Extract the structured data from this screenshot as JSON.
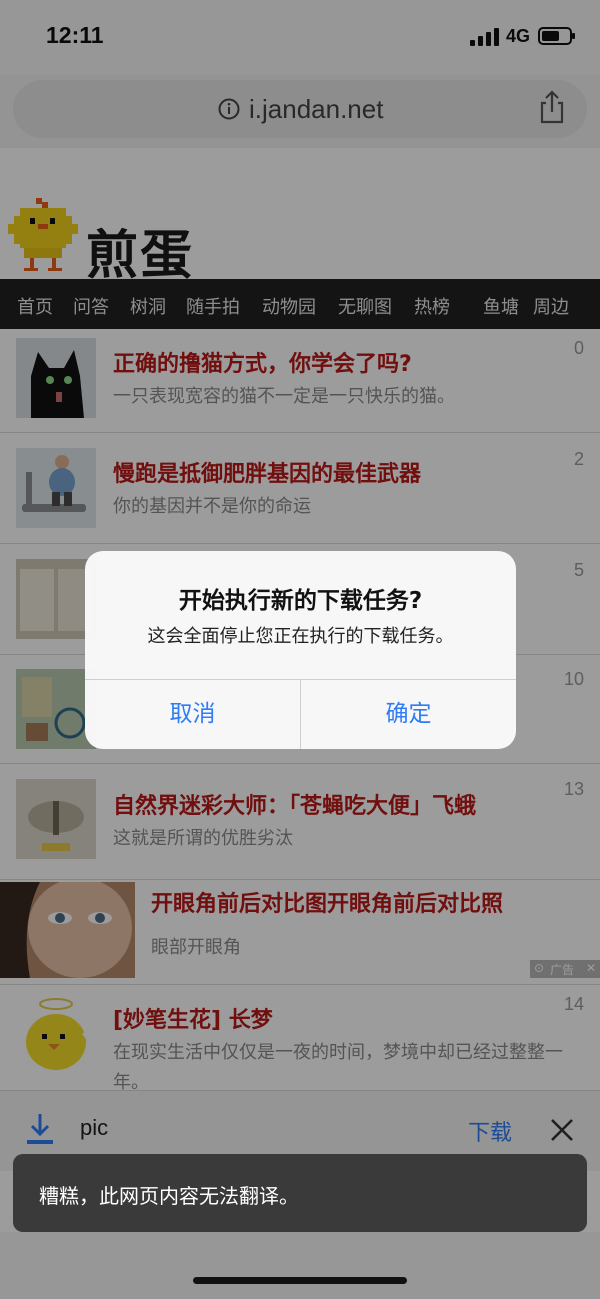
{
  "status_bar": {
    "time": "12:11",
    "network": "4G"
  },
  "address_bar": {
    "url": "i.jandan.net"
  },
  "site": {
    "logo_text": "煎蛋",
    "nav": [
      "首页",
      "问答",
      "树洞",
      "随手拍",
      "动物园",
      "无聊图",
      "热榜",
      "鱼塘",
      "周边"
    ]
  },
  "articles": [
    {
      "title": "正确的撸猫方式，你学会了吗?",
      "subtitle": "一只表现宽容的猫不一定是一只快乐的猫。",
      "count": "0"
    },
    {
      "title": "慢跑是抵御肥胖基因的最佳武器",
      "subtitle": "你的基因并不是你的命运",
      "count": "2"
    },
    {
      "title": "",
      "subtitle": "",
      "count": "5"
    },
    {
      "title": "",
      "subtitle": "",
      "count": "10"
    },
    {
      "title": "自然界迷彩大师：「苍蝇吃大便」飞蛾",
      "subtitle": "这就是所谓的优胜劣汰",
      "count": "13"
    },
    {
      "title": "[妙笔生花] 长梦",
      "subtitle": "在现实生活中仅仅是一夜的时间，梦境中却已经过整整一年。",
      "count": "14"
    }
  ],
  "ad": {
    "title": "开眼角前后对比图开眼角前后对比照",
    "subtitle": "眼部开眼角",
    "label": "广告"
  },
  "dialog": {
    "title": "开始执行新的下载任务?",
    "message": "这会全面停止您正在执行的下载任务。",
    "cancel": "取消",
    "confirm": "确定"
  },
  "download_bar": {
    "file_name": "pic",
    "download_label": "下载"
  },
  "toast": {
    "message": "糟糕，此网页内容无法翻译。"
  },
  "colors": {
    "accent": "#2e7cf6",
    "title_red": "#b91a1a",
    "nav_bg": "#222222"
  }
}
